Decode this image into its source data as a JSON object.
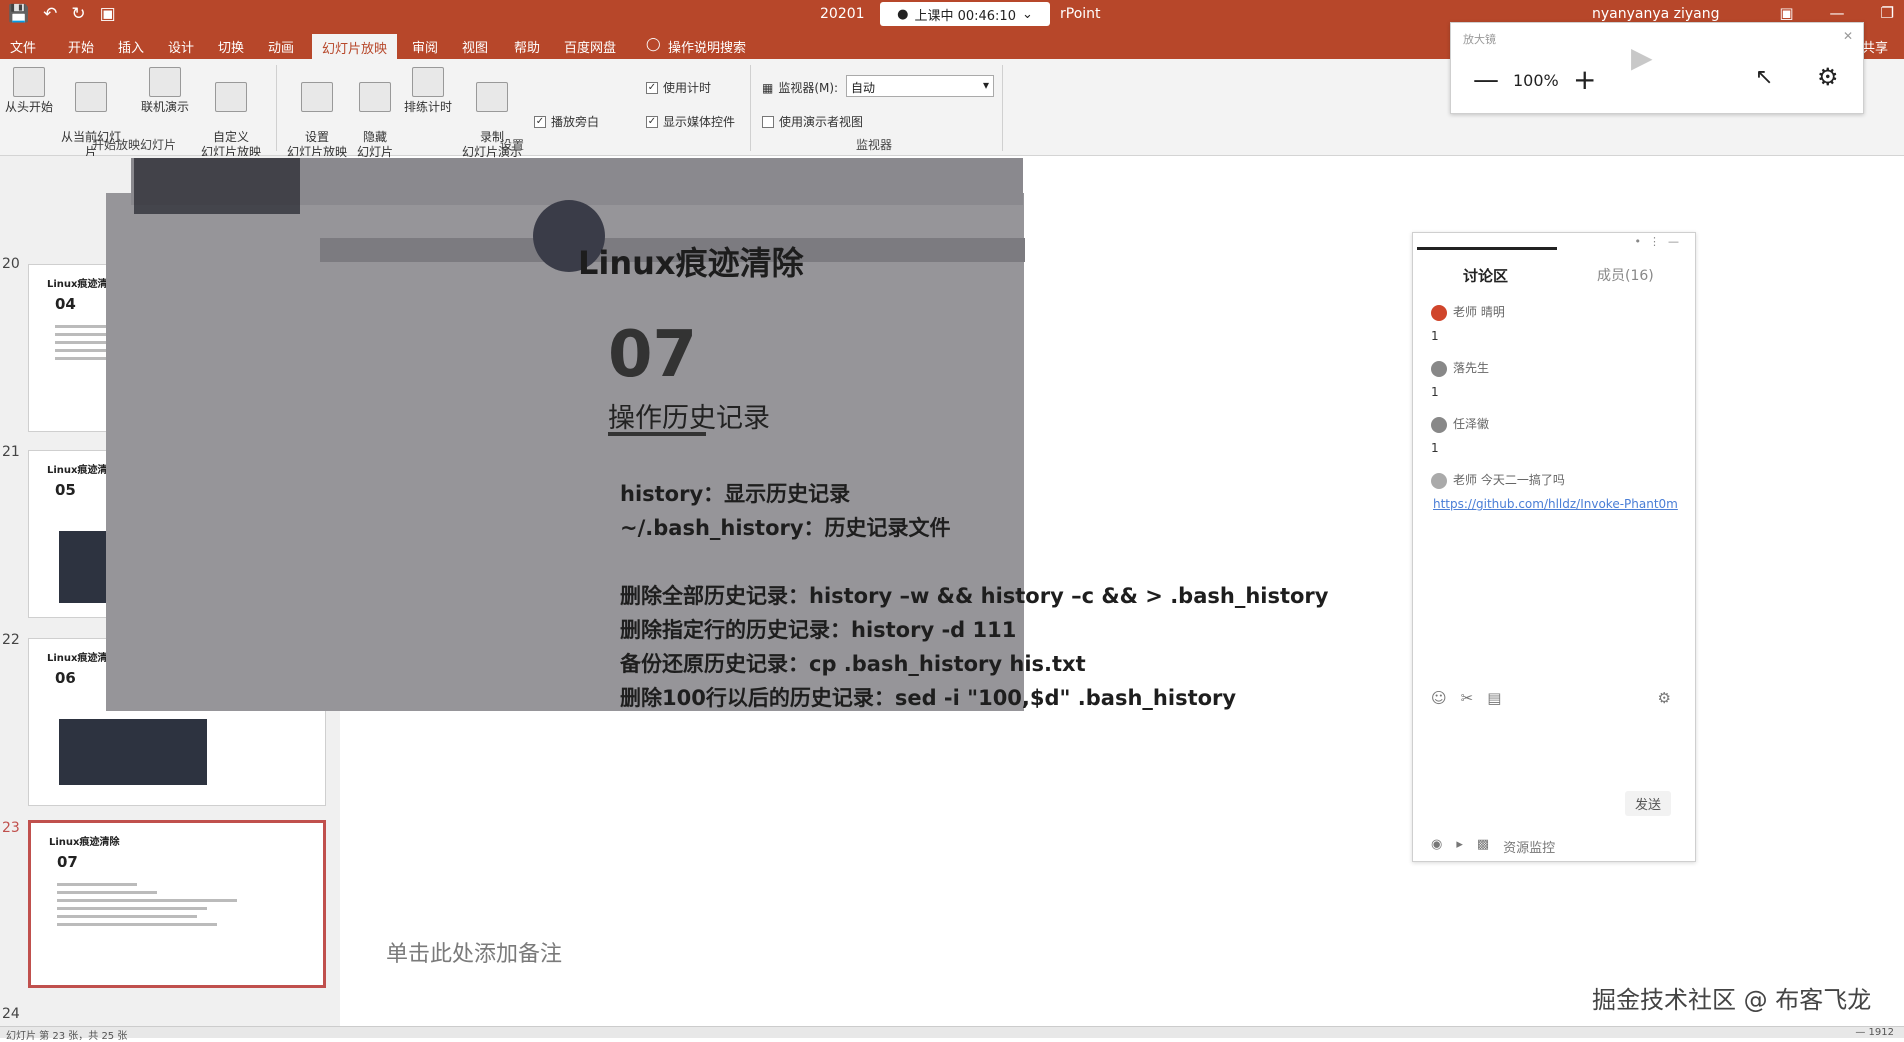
{
  "titlebar": {
    "qat_icons": [
      "save-icon",
      "undo-icon",
      "redo-icon",
      "present-icon"
    ],
    "title_left": "20201",
    "timer": "上课中 00:46:10",
    "title_right": "rPoint",
    "user": "nyanyanya ziyang",
    "controls": [
      "▣",
      "—",
      "❐"
    ]
  },
  "tabs": {
    "items": [
      "文件",
      "开始",
      "插入",
      "设计",
      "切换",
      "动画",
      "幻灯片放映",
      "审阅",
      "视图",
      "帮助",
      "百度网盘",
      "操作说明搜索"
    ],
    "active_index": 6,
    "share": "共享"
  },
  "ribbon": {
    "buttons": [
      {
        "label": "从头开始"
      },
      {
        "label": "从当前幻灯片\n开始"
      },
      {
        "label": "联机演示"
      },
      {
        "label": "自定义\n幻灯片放映"
      },
      {
        "label": "设置\n幻灯片放映"
      },
      {
        "label": "隐藏\n幻灯片"
      },
      {
        "label": "排练计时"
      },
      {
        "label": "录制\n幻灯片演示"
      }
    ],
    "group_start": "开始放映幻灯片",
    "group_setup": "设置",
    "group_monitor": "监视器",
    "checks": [
      {
        "label": "播放旁白",
        "checked": true
      },
      {
        "label": "使用计时",
        "checked": true
      },
      {
        "label": "显示媒体控件",
        "checked": true
      },
      {
        "label": "使用演示者视图",
        "checked": false
      }
    ],
    "monitor_label": "监视器(M):",
    "monitor_value": "自动"
  },
  "thumbnails": [
    {
      "number": "20",
      "title": "Linux痕迹清除",
      "slide_no": "04"
    },
    {
      "number": "21",
      "title": "Linux痕迹清除",
      "slide_no": "05"
    },
    {
      "number": "22",
      "title": "Linux痕迹清除",
      "slide_no": "06"
    },
    {
      "number": "23",
      "title": "Linux痕迹清除",
      "slide_no": "07"
    },
    {
      "number": "24"
    }
  ],
  "slide": {
    "title": "Linux痕迹清除",
    "number": "07",
    "subtitle": "操作历史记录",
    "lines": [
      "history：显示历史记录",
      "~/.bash_history：历史记录文件",
      "删除全部历史记录：history –w && history –c && > .bash_history",
      "删除指定行的历史记录：history -d 111",
      "备份还原历史记录：cp .bash_history his.txt",
      "删除100行以后的历史记录：sed -i \"100,$d\" .bash_history"
    ]
  },
  "notes_placeholder": "单击此处添加备注",
  "zoom": {
    "title": "放大镜",
    "value": "100%",
    "minus": "—",
    "plus": "+"
  },
  "discussion": {
    "tab_discussion": "讨论区",
    "tab_members": "成员(16)",
    "messages": [
      {
        "name": "老师 晴明",
        "text": "1",
        "avatar_color": "#d0452b"
      },
      {
        "name": "落先生",
        "text": "1",
        "avatar_color": "#888888"
      },
      {
        "name": "任泽徽",
        "text": "1",
        "avatar_color": "#888888"
      },
      {
        "name": "老师 今天二一搞了吗",
        "text": "",
        "avatar_color": "#aaaaaa"
      }
    ],
    "link": "https://github.com/hlldz/Invoke-Phant0m",
    "send": "发送",
    "bottom_label": "资源监控"
  },
  "watermark": "掘金技术社区 @ 布客飞龙",
  "status": {
    "left": "幻灯片 第 23 张，共 25 张",
    "right": "— 1912"
  }
}
